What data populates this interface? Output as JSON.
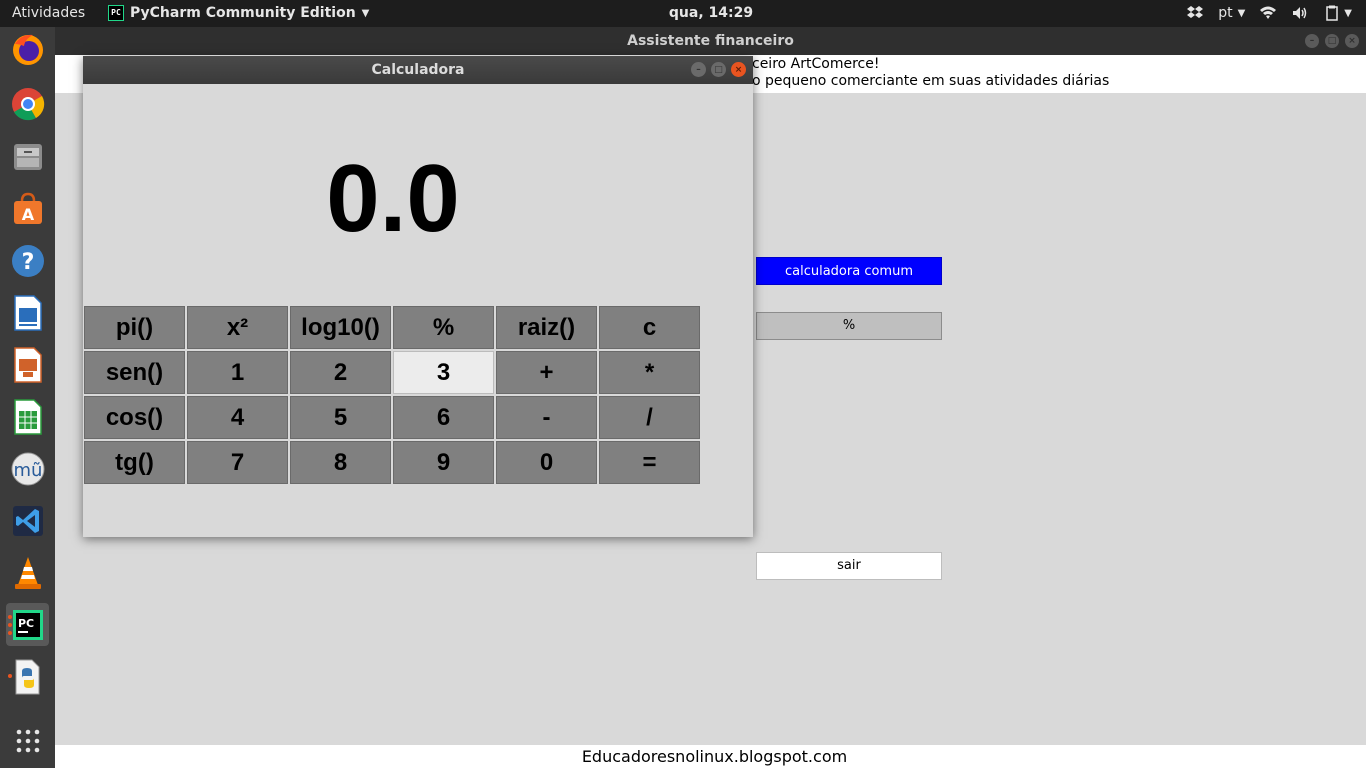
{
  "topbar": {
    "activities": "Atividades",
    "app_name": "PyCharm Community Edition",
    "app_icon": "PC",
    "clock": "qua, 14:29",
    "language": "pt"
  },
  "main_window": {
    "title": "Assistente financeiro",
    "welcome_line1": "ceiro ArtComerce!",
    "welcome_line2": "o pequeno comerciante em suas atividades diárias",
    "buttons": {
      "calculadora_comum": "calculadora comum",
      "percent": "%",
      "sair": "sair"
    },
    "accent_color": "#0000ff"
  },
  "calculator": {
    "title": "Calculadora",
    "display": "0.0",
    "keys": [
      "pi()",
      "x²",
      "log10()",
      "%",
      "raiz()",
      "c",
      "sen()",
      "1",
      "2",
      "3",
      "+",
      "*",
      "cos()",
      "4",
      "5",
      "6",
      "-",
      "/",
      "tg()",
      "7",
      "8",
      "9",
      "0",
      "="
    ]
  },
  "dock": {
    "pc_icon": "PC"
  },
  "footer": "Educadoresnolinux.blogspot.com"
}
